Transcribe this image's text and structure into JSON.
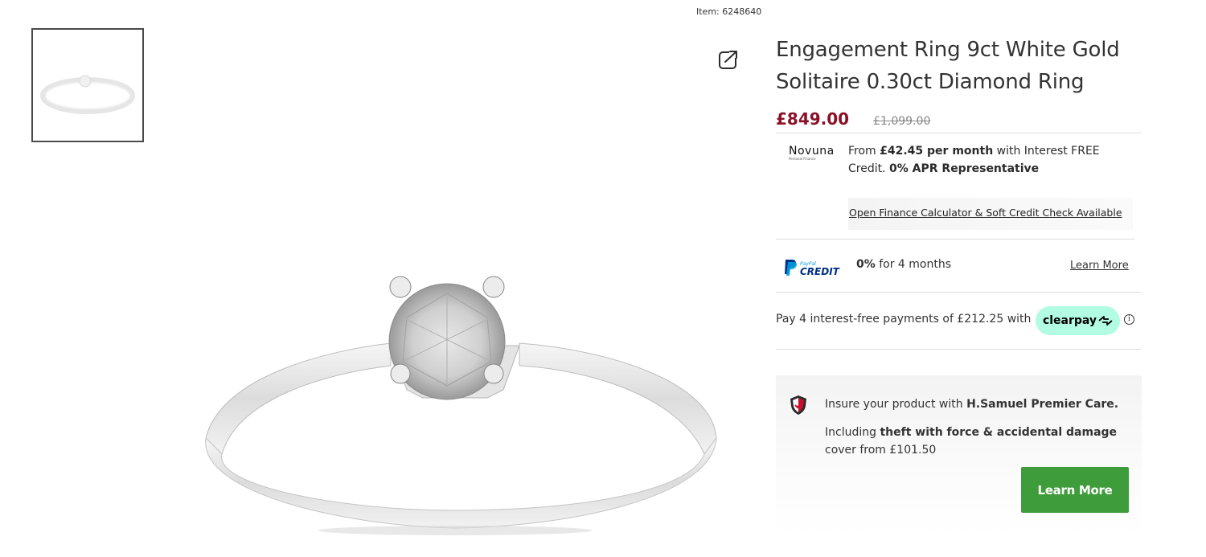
{
  "product": {
    "item_number": "Item: 6248640",
    "title": "Engagement Ring 9ct White Gold Solitaire 0.30ct Diamond Ring",
    "price_now": "£849.00",
    "price_was": "£1,099.00"
  },
  "icons": {
    "share": "share-icon",
    "shield": "shield-icon",
    "info": "info-icon"
  },
  "finance": {
    "logo_name": "Novuna",
    "logo_sub": "Personal Finance",
    "from": "From ",
    "monthly": "£42.45 per month",
    "with": " with Interest FREE Credit. ",
    "apr": "0% APR Representative",
    "calculator_link": "Open Finance Calculator & Soft Credit Check Available"
  },
  "paypal": {
    "logo_top": "PayPal",
    "logo_bottom": "CREDIT",
    "rate": "0%",
    "rate_text": " for 4 months",
    "learn_more": "Learn More"
  },
  "clearpay": {
    "text": "Pay 4 interest-free payments of £212.25 with",
    "badge": "clearpay",
    "info_glyph": "i"
  },
  "care": {
    "title_prefix": "Insure your product with ",
    "title_brand": "H.Samuel Premier Care.",
    "desc_prefix": "Including ",
    "desc_bold": "theft with force & accidental damage",
    "desc_suffix": " cover from £101.50",
    "button": "Learn More"
  },
  "colors": {
    "price": "#8a1127",
    "clearpay_badge": "#b2fce4",
    "care_button": "#3f9c3a"
  }
}
